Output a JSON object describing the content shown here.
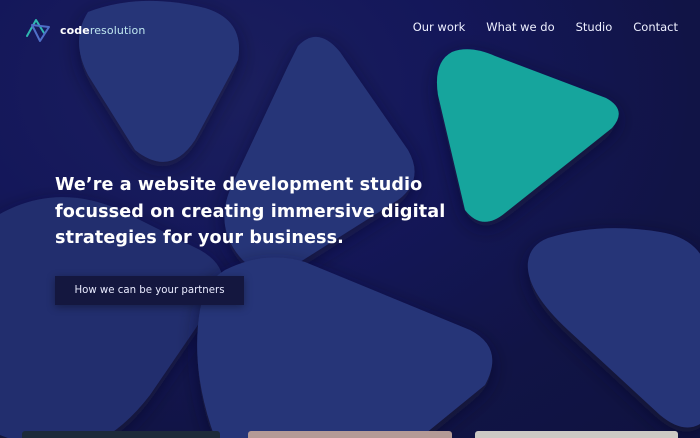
{
  "brand": {
    "name_bold": "code",
    "name_light": "resolution",
    "colors": {
      "background": "#13164a",
      "shape": "#283578",
      "accent": "#17a59d",
      "button": "#14173f"
    }
  },
  "nav": {
    "items": [
      {
        "label": "Our work"
      },
      {
        "label": "What we do"
      },
      {
        "label": "Studio"
      },
      {
        "label": "Contact"
      }
    ]
  },
  "hero": {
    "headline_lines": [
      "We’re a website development studio",
      "focussed on creating immersive digital",
      "strategies for your business."
    ],
    "cta_label": "How we can be your partners"
  },
  "icons": [
    "logo-mark-icon"
  ]
}
